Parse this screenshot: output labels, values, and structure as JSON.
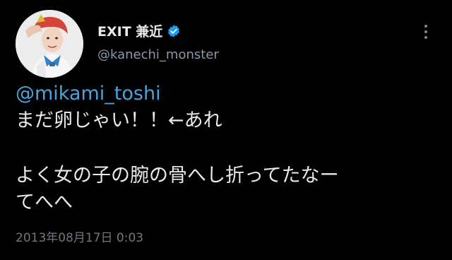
{
  "author": {
    "name": "EXIT 兼近",
    "handle": "@kanechi_monster",
    "verified": true,
    "avatar_icon": "profile-photo-saluting",
    "verified_icon": "verified-badge-icon"
  },
  "menu": {
    "icon": "more-vertical-icon"
  },
  "tweet": {
    "mention": "@mikami_toshi",
    "line1": "まだ卵じゃい！！←あれ",
    "line2": "よく女の子の腕の骨へし折ってたなー",
    "line3": "てへへ",
    "timestamp": "2013年08月17日 0:03"
  },
  "colors": {
    "background": "#000000",
    "text": "#e7e9ea",
    "secondary": "#8b98a5",
    "link": "#4aa3df",
    "verified": "#1d9bf0"
  }
}
